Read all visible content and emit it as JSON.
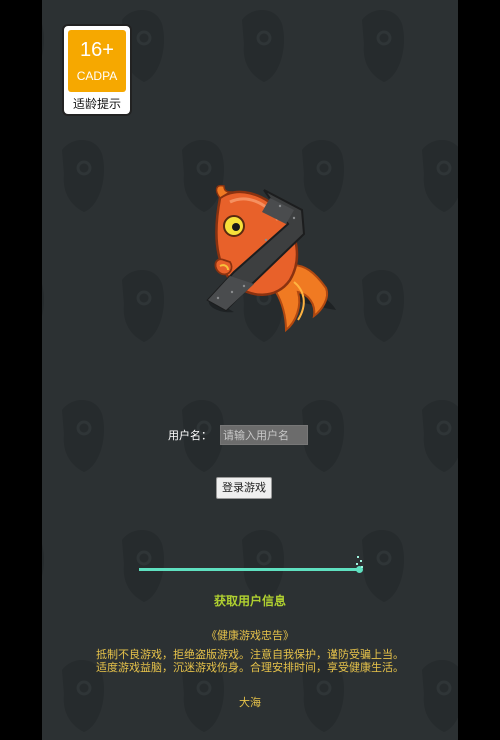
{
  "age_badge": {
    "age": "16+",
    "org": "CADPA",
    "caption": "适龄提示",
    "color": "#f6a800"
  },
  "game": {
    "background_color": "#2c3133",
    "logo_icon": "taped-fish-icon"
  },
  "login": {
    "username_label": "用户名：",
    "username_placeholder": "请输入用户名",
    "username_value": "",
    "submit_label": "登录游戏"
  },
  "loading": {
    "progress": 1.0,
    "status_text": "获取用户信息",
    "accent_color": "#5fe0c0"
  },
  "health_advice": {
    "title": "《健康游戏忠告》",
    "lines": [
      "抵制不良游戏，拒绝盗版游戏。注意自我保护，谨防受骗上当。",
      "适度游戏益脑，沉迷游戏伤身。合理安排时间，享受健康生活。"
    ]
  },
  "author": "大海"
}
